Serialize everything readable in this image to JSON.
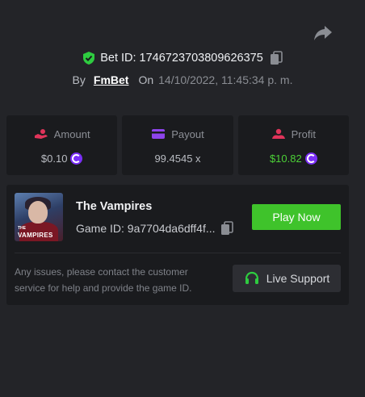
{
  "bet": {
    "id_text": "Bet ID: 1746723703809626375",
    "by_label": "By",
    "user": "FmBet",
    "on_label": "On",
    "date": "14/10/2022, 11:45:34 p. m."
  },
  "stats": {
    "amount_label": "Amount",
    "amount_value": "$0.10",
    "payout_label": "Payout",
    "payout_value": "99.4545 x",
    "profit_label": "Profit",
    "profit_value": "$10.82"
  },
  "game": {
    "thumb_small": "THE",
    "thumb_title": "VAMPIRES",
    "title": "The Vampires",
    "game_id_text": "Game ID: 9a7704da6dff4f...",
    "play_label": "Play Now",
    "note": "Any issues, please contact the customer service for help and provide the game ID.",
    "support_label": "Live Support"
  },
  "colors": {
    "background": "#232428",
    "panel": "#1a1b1e",
    "accent_green": "#3fc32b",
    "profit_green": "#4cd137",
    "coin_purple": "#7b2ff7",
    "amount_icon": "#e0345a",
    "payout_icon": "#8e44ec",
    "profit_icon": "#e0345a",
    "shield": "#2ecc40"
  },
  "icons": {
    "share": "share-icon",
    "shield": "shield-check-icon",
    "copy": "copy-icon",
    "amount": "hand-coin-icon",
    "payout": "card-icon",
    "profit": "user-money-icon",
    "coin": "coin-icon",
    "support": "headset-icon"
  }
}
